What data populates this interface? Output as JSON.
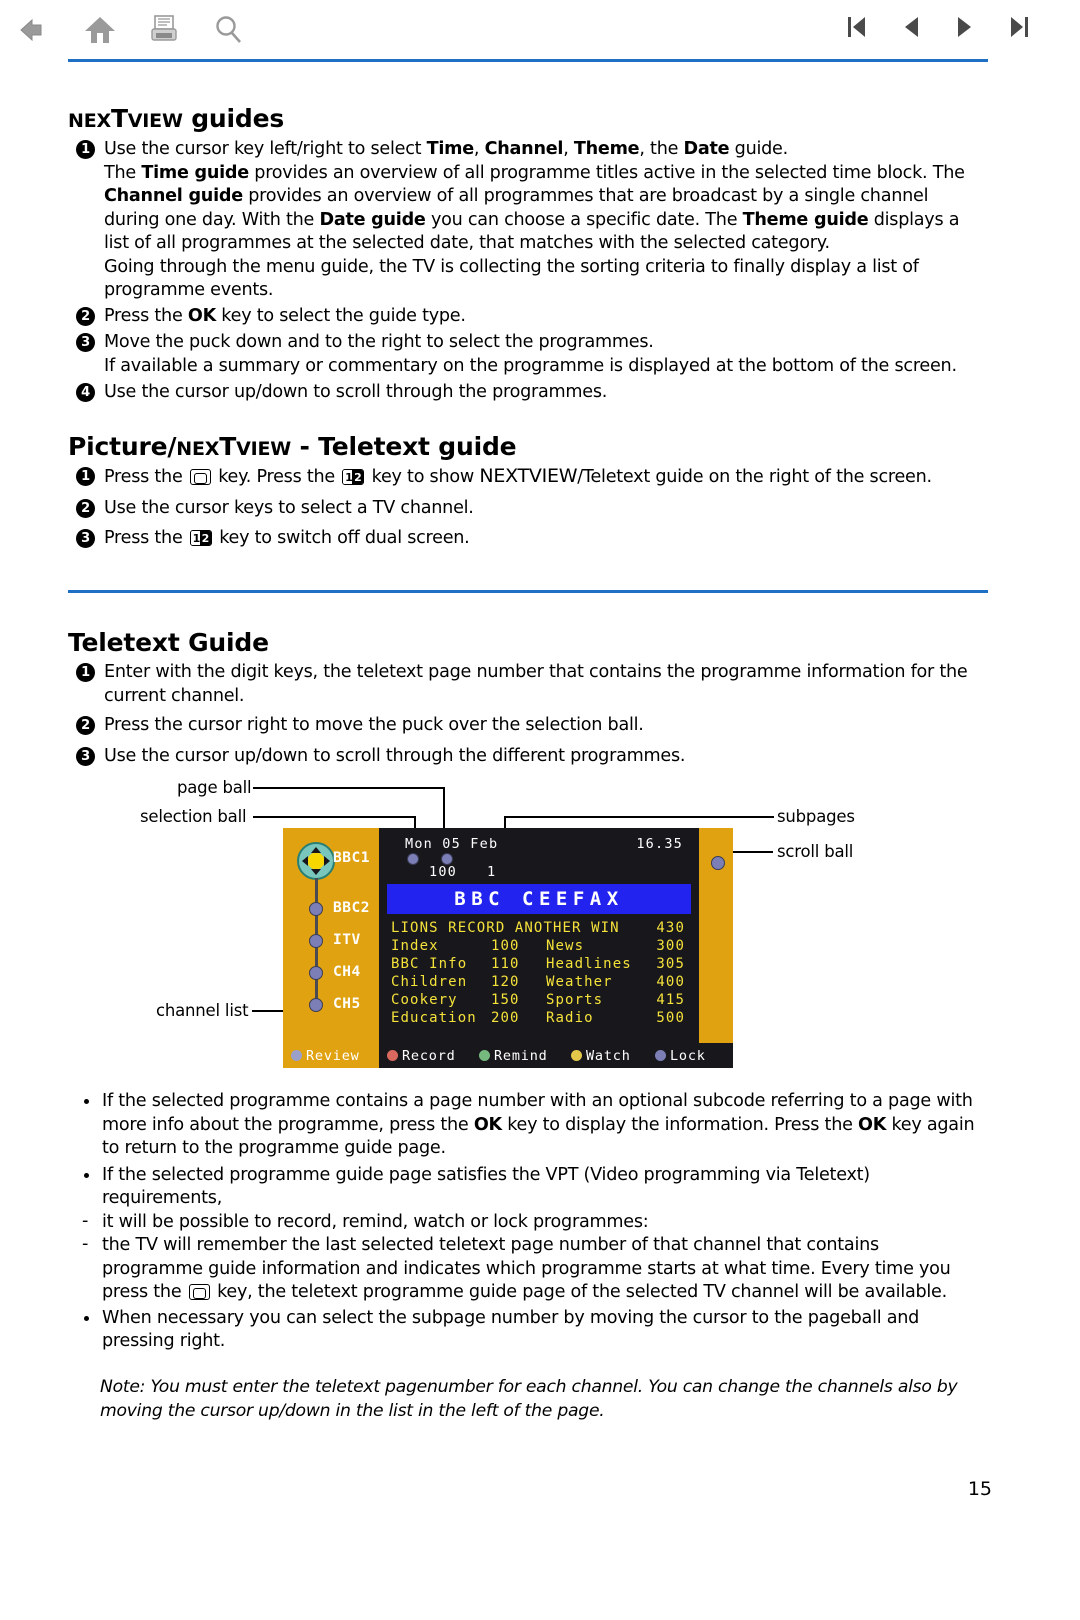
{
  "toolbar": {
    "left_icons": [
      {
        "name": "back-arrow-icon",
        "label": "Back"
      },
      {
        "name": "home-icon",
        "label": "Home"
      },
      {
        "name": "print-icon",
        "label": "Print"
      },
      {
        "name": "search-icon",
        "label": "Search"
      }
    ],
    "right_icons": [
      {
        "name": "first-page-icon",
        "label": "First page"
      },
      {
        "name": "previous-page-icon",
        "label": "Previous page"
      },
      {
        "name": "next-page-icon",
        "label": "Next page"
      },
      {
        "name": "last-page-icon",
        "label": "Last page"
      }
    ],
    "rule_color": "#1f6fc4"
  },
  "section1": {
    "title_pre": "NEX",
    "title_t": "T",
    "title_view": "VIEW",
    "title_rest": " guides",
    "items": [
      {
        "num": "1"
      },
      {
        "num": "2"
      },
      {
        "num": "3"
      },
      {
        "num": "4"
      }
    ],
    "item1_l1_a": "Use the cursor key left/right to select ",
    "item1_b_time": "Time",
    "item1_l1_b": ", ",
    "item1_b_channel": "Channel",
    "item1_l1_c": ", ",
    "item1_b_theme": "Theme",
    "item1_l1_d": ", the ",
    "item1_b_date": "Date",
    "item1_l1_e": " guide.",
    "item1_l2_a": "The ",
    "item1_b_timeguide": "Time guide",
    "item1_l2_b": " provides an overview of all programme titles active in the selected time block. The ",
    "item1_b_channelguide": "Channel guide",
    "item1_l2_c": " provides an overview of all programmes that are broadcast by a single channel during one day.  With the ",
    "item1_b_dateguide": "Date guide",
    "item1_l2_d": " you can choose a specific date. The ",
    "item1_b_themeguide": "Theme guide",
    "item1_l2_e": " displays a list of all programmes at the selected date, that matches with the selected category.",
    "item1_l3": "Going through the menu guide, the TV is collecting the sorting criteria to finally display a list of programme events.",
    "item2_a": "Press the ",
    "item2_ok": "OK",
    "item2_b": " key to select the guide type.",
    "item3_l1": "Move the puck down and to the right to select the programmes.",
    "item3_l2": "If available a summary or commentary on the programme is displayed at the bottom of the screen.",
    "item4": "Use the cursor up/down to scroll through the programmes."
  },
  "section2": {
    "title_a": "Picture/",
    "title_nex": "NEX",
    "title_t": "T",
    "title_view": "VIEW",
    "title_rest": " - Teletext guide",
    "item1_a": "Press the ",
    "item1_b": " key. Press the ",
    "item1_c": " key to show ",
    "item1_nex": "NEX",
    "item1_t": "T",
    "item1_view": "VIEW",
    "item1_d": "/Teletext guide on the right of the screen.",
    "item2": "Use the cursor keys to select a TV channel.",
    "item3_a": "Press the ",
    "item3_b": " key to switch off dual screen.",
    "key_book_label": "teletext-key",
    "key_12_label": "dual-screen-key",
    "key_12_digit1": "1",
    "key_12_digit2": "2"
  },
  "section3": {
    "title": "Teletext Guide",
    "item1_l1": "Enter with the digit keys, the teletext page number that contains the programme information for the",
    "item1_l2": "current channel.",
    "item2": "Press the cursor right to move the puck over the selection ball.",
    "item3": "Use the cursor up/down to scroll through the different programmes."
  },
  "diagram": {
    "labels": {
      "page_ball": "page ball",
      "selection_ball": "selection ball",
      "channel_list": "channel list",
      "subpages": "subpages",
      "scroll_ball": "scroll ball"
    },
    "colors": {
      "bezel": "#e0a210",
      "screen": "#17171c",
      "banner": "#2323ef",
      "text_yellow": "#f5e23a",
      "ball": "#7b7fb5"
    },
    "channels": [
      "BBC1",
      "BBC2",
      "ITV",
      "CH4",
      "CH5"
    ],
    "screen": {
      "date": "Mon 05 Feb",
      "time": "16.35",
      "page_number": "100",
      "subpage_number": "1",
      "banner": "BBC  CEEFAX",
      "headline": "LIONS RECORD ANOTHER WIN",
      "headline_page": "430",
      "rows": [
        {
          "left_name": "Index",
          "left_page": "100",
          "right_name": "News",
          "right_page": "300"
        },
        {
          "left_name": "BBC Info",
          "left_page": "110",
          "right_name": "Headlines",
          "right_page": "305"
        },
        {
          "left_name": "Children",
          "left_page": "120",
          "right_name": "Weather",
          "right_page": "400"
        },
        {
          "left_name": "Cookery",
          "left_page": "150",
          "right_name": "Sports",
          "right_page": "415"
        },
        {
          "left_name": "Education",
          "left_page": "200",
          "right_name": "Radio",
          "right_page": "500"
        }
      ],
      "bottom_bar": [
        {
          "label": "Review",
          "color": "#9ba0c8"
        },
        {
          "label": "Record",
          "color": "#d9695e"
        },
        {
          "label": "Remind",
          "color": "#76b97e"
        },
        {
          "label": "Watch",
          "color": "#e3c84a"
        },
        {
          "label": "Lock",
          "color": "#7b7fb5"
        }
      ]
    }
  },
  "bullets": {
    "b1_a": "If the selected programme contains a page number with an optional subcode referring to a page with more info about the programme, press the ",
    "b1_ok1": "OK",
    "b1_b": " key to display the information. Press the ",
    "b1_ok2": "OK",
    "b1_c": " key again to return to the programme guide page.",
    "b2": "If the selected programme guide page satisfies the VPT (Video programming via Teletext) requirements,",
    "d1": "it will be possible to record, remind, watch or lock programmes:",
    "d2_a": "the TV will remember the last selected teletext page number of that channel that contains programme guide information and indicates which programme starts at what time. Every time you press the ",
    "d2_b": " key, the teletext programme guide page of the selected TV channel will be available.",
    "b3": "When necessary you can select the subpage number by moving the cursor to the pageball and pressing right."
  },
  "note": "Note: You must enter the teletext pagenumber for each channel. You can change the channels also by moving the cursor up/down in the list in the left of the page.",
  "page_number": "15"
}
